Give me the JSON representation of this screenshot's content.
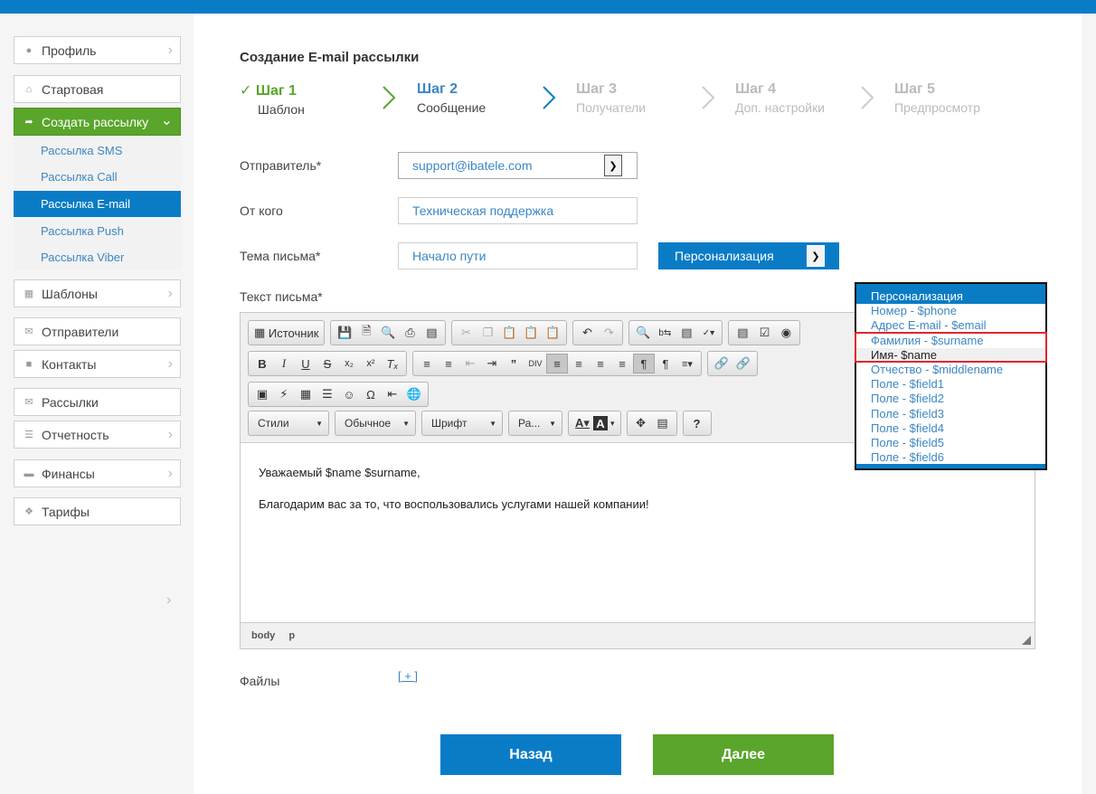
{
  "sidebar": {
    "items": [
      {
        "label": "Профиль",
        "icon": "user-icon"
      },
      {
        "label": "Стартовая",
        "icon": "home-icon"
      },
      {
        "label": "Создать рассылку",
        "icon": "share-arrow-icon"
      },
      {
        "label": "Шаблоны",
        "icon": "template-icon"
      },
      {
        "label": "Отправители",
        "icon": "sender-icon"
      },
      {
        "label": "Контакты",
        "icon": "contacts-icon"
      },
      {
        "label": "Рассылки",
        "icon": "envelope-icon"
      },
      {
        "label": "Отчетность",
        "icon": "report-icon"
      },
      {
        "label": "Финансы",
        "icon": "wallet-icon"
      },
      {
        "label": "Тарифы",
        "icon": "tag-icon"
      }
    ],
    "sub_items": [
      "Рассылка SMS",
      "Рассылка Call",
      "Рассылка E-mail",
      "Рассылка Push",
      "Рассылка Viber"
    ]
  },
  "page_title": "Создание E-mail рассылки",
  "steps": [
    {
      "num": "Шаг 1",
      "desc": "Шаблон",
      "state": "done"
    },
    {
      "num": "Шаг 2",
      "desc": "Сообщение",
      "state": "current"
    },
    {
      "num": "Шаг 3",
      "desc": "Получатели",
      "state": "todo"
    },
    {
      "num": "Шаг 4",
      "desc": "Доп. настройки",
      "state": "todo"
    },
    {
      "num": "Шаг 5",
      "desc": "Предпросмотр",
      "state": "todo"
    }
  ],
  "form": {
    "sender_label": "Отправитель*",
    "sender_value": "support@ibatele.com",
    "from_label": "От кого",
    "from_value": "Техническая поддержка",
    "subject_label": "Тема письма*",
    "subject_value": "Начало пути",
    "personalization_label": "Персонализация",
    "body_label": "Текст письма*"
  },
  "editor": {
    "source_label": "Источник",
    "styles_label": "Стили",
    "format_label": "Обычное",
    "font_label": "Шрифт",
    "size_label": "Ра...",
    "content_lines": [
      "Уважаемый $name $surname,",
      "Благодарим вас за то, что воспользовались услугами нашей компании!"
    ],
    "status_path": [
      "body",
      "p"
    ]
  },
  "personalization_menu": {
    "options": [
      "Персонализация",
      "Номер - $phone",
      "Адрес E-mail - $email",
      "Фамилия - $surname",
      "Имя- $name",
      "Отчество - $middlename",
      "Поле - $field1",
      "Поле - $field2",
      "Поле - $field3",
      "Поле - $field4",
      "Поле - $field5",
      "Поле - $field6"
    ]
  },
  "files": {
    "label": "Файлы",
    "add_label": "[ + ]"
  },
  "buttons": {
    "back": "Назад",
    "next": "Далее"
  },
  "colors": {
    "brand_blue": "#0a7cc6",
    "brand_green": "#5aa52b",
    "highlight_red": "#e0262d"
  }
}
